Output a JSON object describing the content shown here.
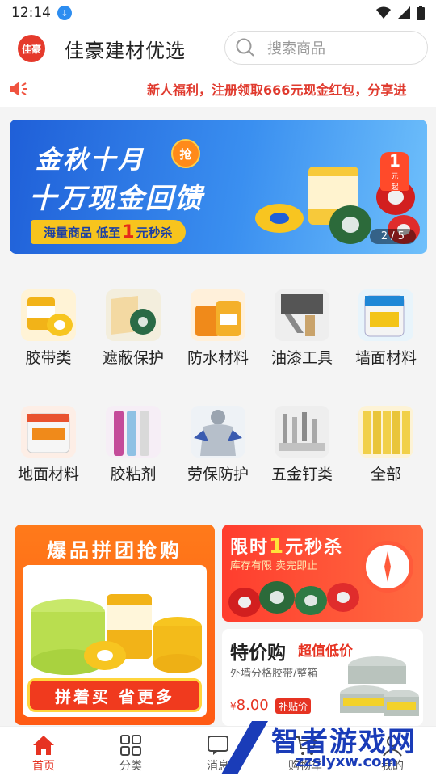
{
  "status_bar": {
    "time": "12:14"
  },
  "header": {
    "logo_text": "佳豪",
    "title": "佳豪建材优选",
    "search_placeholder": "搜索商品"
  },
  "notice": {
    "text": "新人福利，注册领取666元现金红包，分享进"
  },
  "banner": {
    "title_line1": "金秋十月",
    "badge": "抢",
    "title_line2": "十万现金回馈",
    "pill_prefix": "海量商品  低至",
    "pill_number": "1",
    "pill_suffix": "元秒杀",
    "tag_number": "1",
    "tag_unit": "元",
    "tag_sub": "起",
    "page_indicator": "2 / 5"
  },
  "categories": [
    {
      "label": "胶带类",
      "icon": "tape-icon"
    },
    {
      "label": "遮蔽保护",
      "icon": "masking-film-icon"
    },
    {
      "label": "防水材料",
      "icon": "waterproof-icon"
    },
    {
      "label": "油漆工具",
      "icon": "paint-tools-icon"
    },
    {
      "label": "墙面材料",
      "icon": "wall-material-icon"
    },
    {
      "label": "地面材料",
      "icon": "floor-material-icon"
    },
    {
      "label": "胶粘剂",
      "icon": "adhesive-icon"
    },
    {
      "label": "劳保防护",
      "icon": "protection-icon"
    },
    {
      "label": "五金钉类",
      "icon": "hardware-icon"
    },
    {
      "label": "全部",
      "icon": "all-icon"
    }
  ],
  "promo_group": {
    "title": "爆品拼团抢购",
    "cta": "拼着买 省更多"
  },
  "promo_flash": {
    "title_prefix": "限时",
    "title_number": "1",
    "title_suffix": "元秒杀",
    "subtitle": "库存有限 卖完即止"
  },
  "promo_special": {
    "title": "特价购",
    "tagline": "超值低价",
    "desc": "外墙分格胶带/整箱",
    "currency": "¥",
    "price": "8.00",
    "subsidy": "补贴价"
  },
  "bottom_nav": [
    {
      "label": "首页",
      "icon": "home-icon",
      "active": true
    },
    {
      "label": "分类",
      "icon": "grid-icon",
      "active": false
    },
    {
      "label": "消息",
      "icon": "message-icon",
      "active": false
    },
    {
      "label": "购物车",
      "icon": "cart-icon",
      "active": false
    },
    {
      "label": "我的",
      "icon": "user-icon",
      "active": false
    }
  ],
  "watermark": {
    "line1": "智者游戏网",
    "line2": "zzslyxw.com"
  },
  "colors": {
    "brand_red": "#e63322",
    "banner_blue": "#1f5fd8",
    "orange": "#ff5a14"
  }
}
